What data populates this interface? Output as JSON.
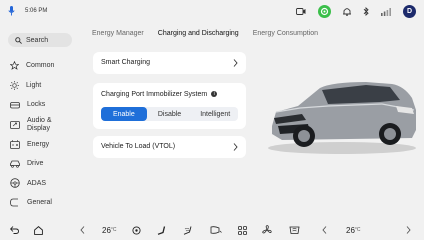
{
  "status_bar": {
    "time": "5:06 PM",
    "icons": [
      "mic-icon",
      "camera-icon",
      "green-app-icon",
      "bell-icon",
      "bluetooth-icon",
      "signal-icon",
      "profile-avatar"
    ],
    "avatar_letter": "D",
    "colors": {
      "accent": "#1f6fd9",
      "green": "#3bbf4a",
      "avatar": "#1c2a6b"
    }
  },
  "sidebar": {
    "search_label": "Search",
    "items": [
      {
        "label": "Common",
        "icon": "star-icon"
      },
      {
        "label": "Light",
        "icon": "sun-icon"
      },
      {
        "label": "Locks",
        "icon": "lock-icon"
      },
      {
        "label": "Audio &",
        "label2": "Display",
        "icon": "display-icon"
      },
      {
        "label": "Energy",
        "icon": "battery-icon"
      },
      {
        "label": "Drive",
        "icon": "car-icon"
      },
      {
        "label": "ADAS",
        "icon": "steering-icon"
      },
      {
        "label": "General",
        "icon": "general-icon"
      }
    ]
  },
  "tabs": [
    {
      "label": "Energy Manager",
      "active": false
    },
    {
      "label": "Charging and Discharging",
      "active": true
    },
    {
      "label": "Energy Consumption",
      "active": false
    }
  ],
  "cards": {
    "smart_charging": "Smart Charging",
    "immobilizer_title": "Charging Port Immobilizer System",
    "immobilizer_options": [
      "Enable",
      "Disable",
      "Intelligent"
    ],
    "immobilizer_selected": "Enable",
    "vtol": "Vehicle To Load (VTOL)"
  },
  "bottom_bar": {
    "left_temp": "26",
    "right_temp": "26",
    "temp_unit": "°C"
  }
}
